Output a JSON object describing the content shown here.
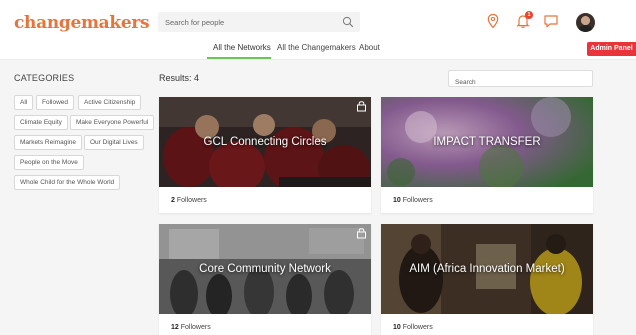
{
  "header": {
    "logo_text": "changemakers",
    "search_placeholder": "Search for people",
    "notification_count": "1",
    "colors": {
      "brand": "#e8743b",
      "icon": "#e8743b",
      "active_tab": "#6dc25a",
      "admin": "#e8353a"
    }
  },
  "nav": {
    "tabs": [
      {
        "label": "All the Networks"
      },
      {
        "label": "All the Changemakers"
      },
      {
        "label": "About"
      }
    ],
    "admin_label": "Admin Panel"
  },
  "sidebar": {
    "title": "CATEGORIES",
    "categories": [
      "All",
      "Followed",
      "Active Citizenship",
      "Climate Equity",
      "Make Everyone Powerful",
      "Markets Reimagine",
      "Our Digital Lives",
      "People on the Move",
      "Whole Child for the Whole World"
    ]
  },
  "main": {
    "results_label": "Results: 4",
    "search_placeholder": "Search",
    "followers_word": "Followers",
    "cards": [
      {
        "title": "GCL Connecting Circles",
        "followers": "2",
        "locked": true
      },
      {
        "title": "IMPACT TRANSFER",
        "followers": "10",
        "locked": false
      },
      {
        "title": "Core Community Network",
        "followers": "12",
        "locked": true
      },
      {
        "title": "AIM (Africa Innovation Market)",
        "followers": "10",
        "locked": false
      }
    ]
  }
}
